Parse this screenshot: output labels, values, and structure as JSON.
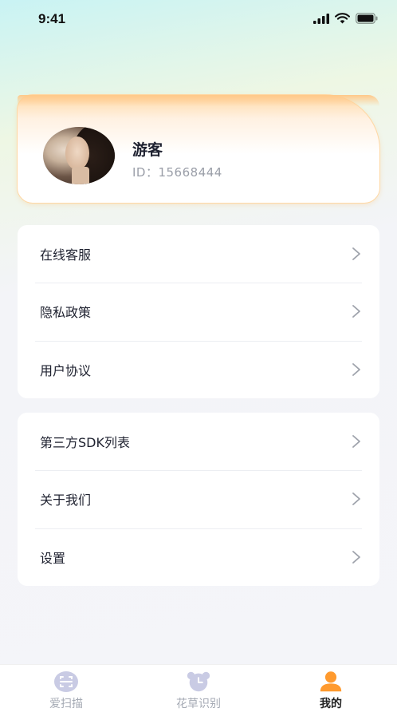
{
  "status_bar": {
    "time": "9:41"
  },
  "profile": {
    "name": "游客",
    "id_text": "ID：15668444"
  },
  "menu_groups": [
    {
      "items": [
        {
          "label": "在线客服"
        },
        {
          "label": "隐私政策"
        },
        {
          "label": "用户协议"
        }
      ]
    },
    {
      "items": [
        {
          "label": "第三方SDK列表"
        },
        {
          "label": "关于我们"
        },
        {
          "label": "设置"
        }
      ]
    }
  ],
  "tabs": [
    {
      "label": "爱扫描",
      "icon": "scan-icon",
      "active": false
    },
    {
      "label": "花草识别",
      "icon": "alarm-clock-icon",
      "active": false
    },
    {
      "label": "我的",
      "icon": "person-icon",
      "active": true
    }
  ],
  "colors": {
    "accent": "#ff9a2e",
    "card_border": "#ffd7a3",
    "tab_inactive": "#a5aab4"
  }
}
